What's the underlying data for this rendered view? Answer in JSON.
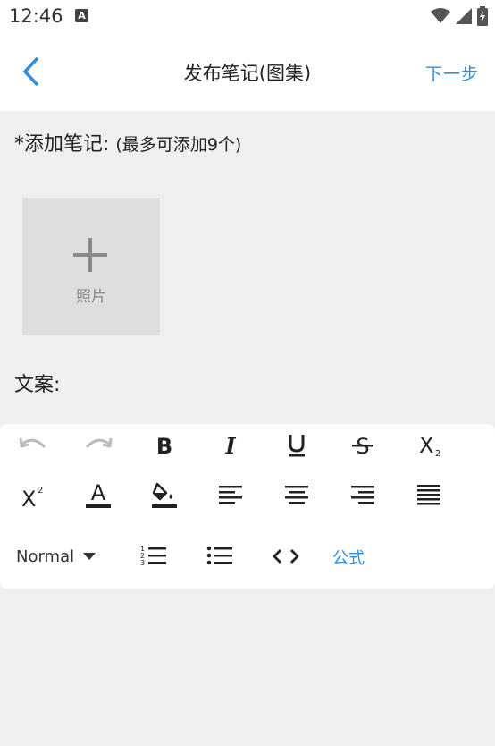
{
  "statusbar": {
    "time": "12:46",
    "notification_glyph": "A"
  },
  "appbar": {
    "title": "发布笔记(图集)",
    "next_label": "下一步"
  },
  "content": {
    "add_note_label": "*添加笔记:",
    "add_note_hint": "(最多可添加9个)",
    "photo_label": "照片",
    "copy_label": "文案:"
  },
  "toolbar": {
    "style_select_value": "Normal",
    "formula_label": "公式",
    "icons": [
      "undo-icon",
      "redo-icon",
      "bold-icon",
      "italic-icon",
      "underline-icon",
      "strikethrough-icon",
      "subscript-icon",
      "superscript-icon",
      "text-color-icon",
      "background-color-icon",
      "align-left-icon",
      "align-center-icon",
      "align-right-icon",
      "align-justify-icon",
      "ordered-list-icon",
      "bullet-list-icon",
      "code-icon"
    ]
  },
  "colors": {
    "accent": "#2f8fdc",
    "background": "#efefef",
    "tile": "#dedede"
  }
}
